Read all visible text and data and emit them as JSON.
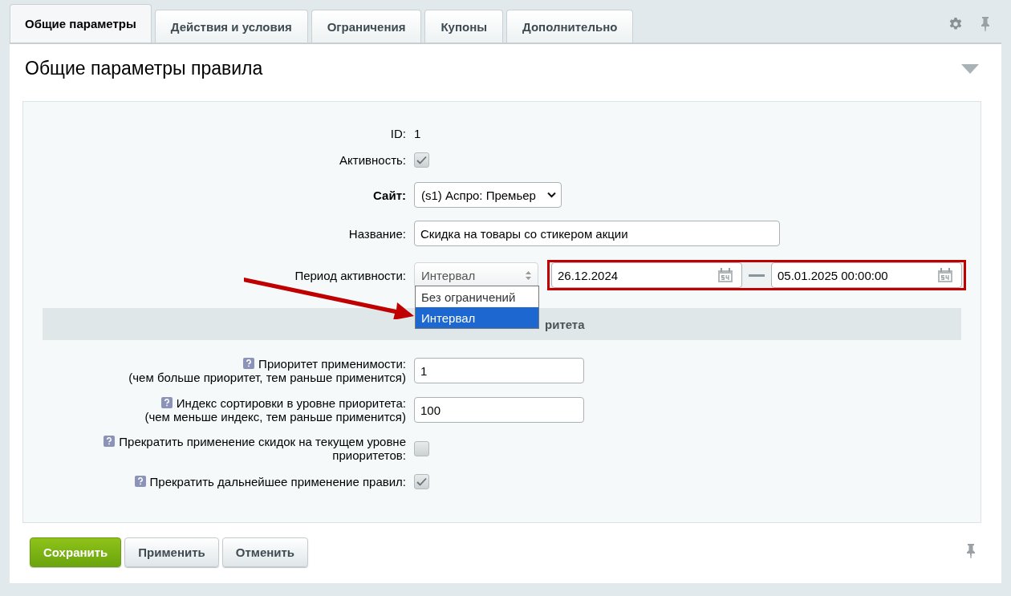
{
  "tabs": [
    {
      "label": "Общие параметры",
      "selected": true
    },
    {
      "label": "Действия и условия",
      "selected": false
    },
    {
      "label": "Ограничения",
      "selected": false
    },
    {
      "label": "Купоны",
      "selected": false
    },
    {
      "label": "Дополнительно",
      "selected": false
    }
  ],
  "title": "Общие параметры правила",
  "fields": [
    {
      "kind": "text",
      "label": "ID:",
      "required": false,
      "value": "1"
    },
    {
      "kind": "checkbox",
      "label": "Активность:",
      "required": false,
      "checked": true
    },
    {
      "kind": "select",
      "label": "Сайт:",
      "required": true,
      "value": "(s1) Аспро: Премьер"
    },
    {
      "kind": "input",
      "label": "Название:",
      "required": false,
      "value": "Скидка на товары со стикером акции"
    },
    {
      "kind": "period",
      "label": "Период активности:",
      "required": false,
      "value": "Интервал",
      "from": "26.12.2024",
      "to": "05.01.2025 00:00:00",
      "options": [
        {
          "label": "Без ограничений",
          "selected": false
        },
        {
          "label": "Интервал",
          "selected": true
        }
      ]
    }
  ],
  "section": "ритета",
  "priority_fields": [
    {
      "kind": "input",
      "label": "Приоритет применимости:",
      "note": "(чем больше приоритет, тем раньше применится)",
      "value": "1"
    },
    {
      "kind": "input",
      "label": "Индекс сортировки в уровне приоритета:",
      "note": "(чем меньше индекс, тем раньше применится)",
      "value": "100"
    },
    {
      "kind": "checkbox",
      "label": "Прекратить применение скидок на текущем уровне приоритетов:",
      "checked": false
    },
    {
      "kind": "checkbox",
      "label": "Прекратить дальнейшее применение правил:",
      "checked": true
    }
  ],
  "buttons": [
    {
      "label": "Сохранить",
      "kind": "primary"
    },
    {
      "label": "Применить",
      "kind": "secondary"
    },
    {
      "label": "Отменить",
      "kind": "secondary"
    }
  ]
}
